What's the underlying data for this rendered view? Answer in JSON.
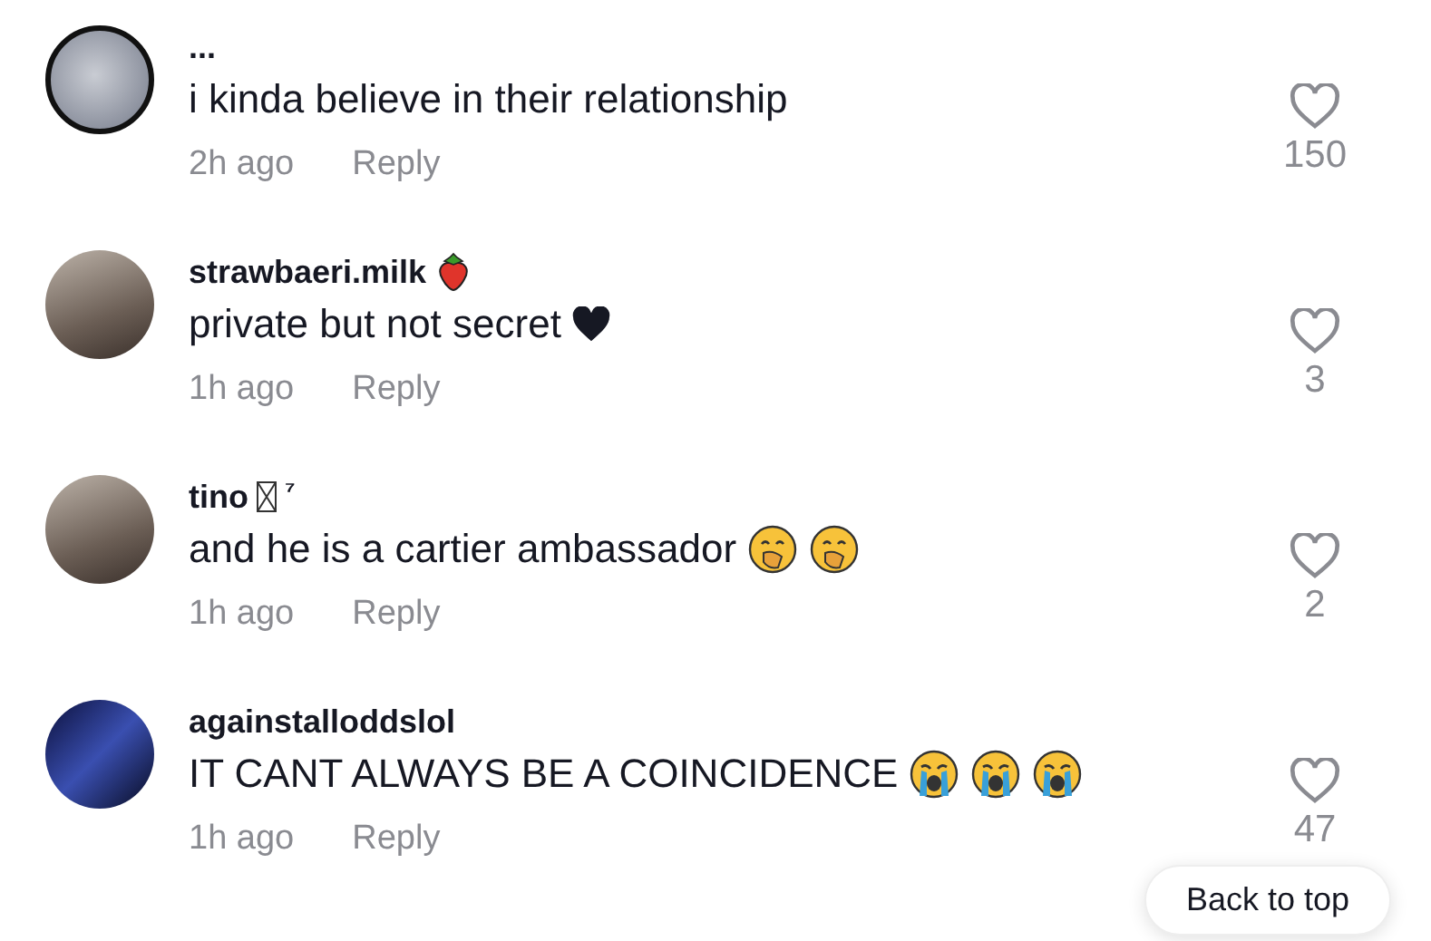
{
  "comments": [
    {
      "avatar": {
        "kind": "moon"
      },
      "name": "...",
      "text": "i kinda believe in their relationship",
      "time": "2h ago",
      "reply": "Reply",
      "likes": "150"
    },
    {
      "avatar": {
        "kind": "photo"
      },
      "name": "strawbaeri.milk",
      "name_icons": [
        {
          "kind": "strawberry"
        }
      ],
      "text": "private but not secret",
      "text_icons": [
        {
          "kind": "black-heart"
        }
      ],
      "time": "1h ago",
      "reply": "Reply",
      "likes": "3"
    },
    {
      "avatar": {
        "kind": "photo"
      },
      "name": "tino",
      "name_icons": [
        {
          "kind": "missing-glyph"
        }
      ],
      "name_suffix": "⁷",
      "text": "and he is a cartier ambassador",
      "text_icons": [
        {
          "kind": "hand-over-mouth"
        },
        {
          "kind": "hand-over-mouth"
        }
      ],
      "time": "1h ago",
      "reply": "Reply",
      "likes": "2"
    },
    {
      "avatar": {
        "kind": "dark-photo"
      },
      "name": "againstalloddslol",
      "text": "IT CANT ALWAYS BE A COINCIDENCE",
      "text_icons": [
        {
          "kind": "crying"
        },
        {
          "kind": "crying"
        },
        {
          "kind": "crying"
        }
      ],
      "time": "1h ago",
      "reply": "Reply",
      "likes": "47"
    }
  ],
  "back_to_top": "Back to top"
}
